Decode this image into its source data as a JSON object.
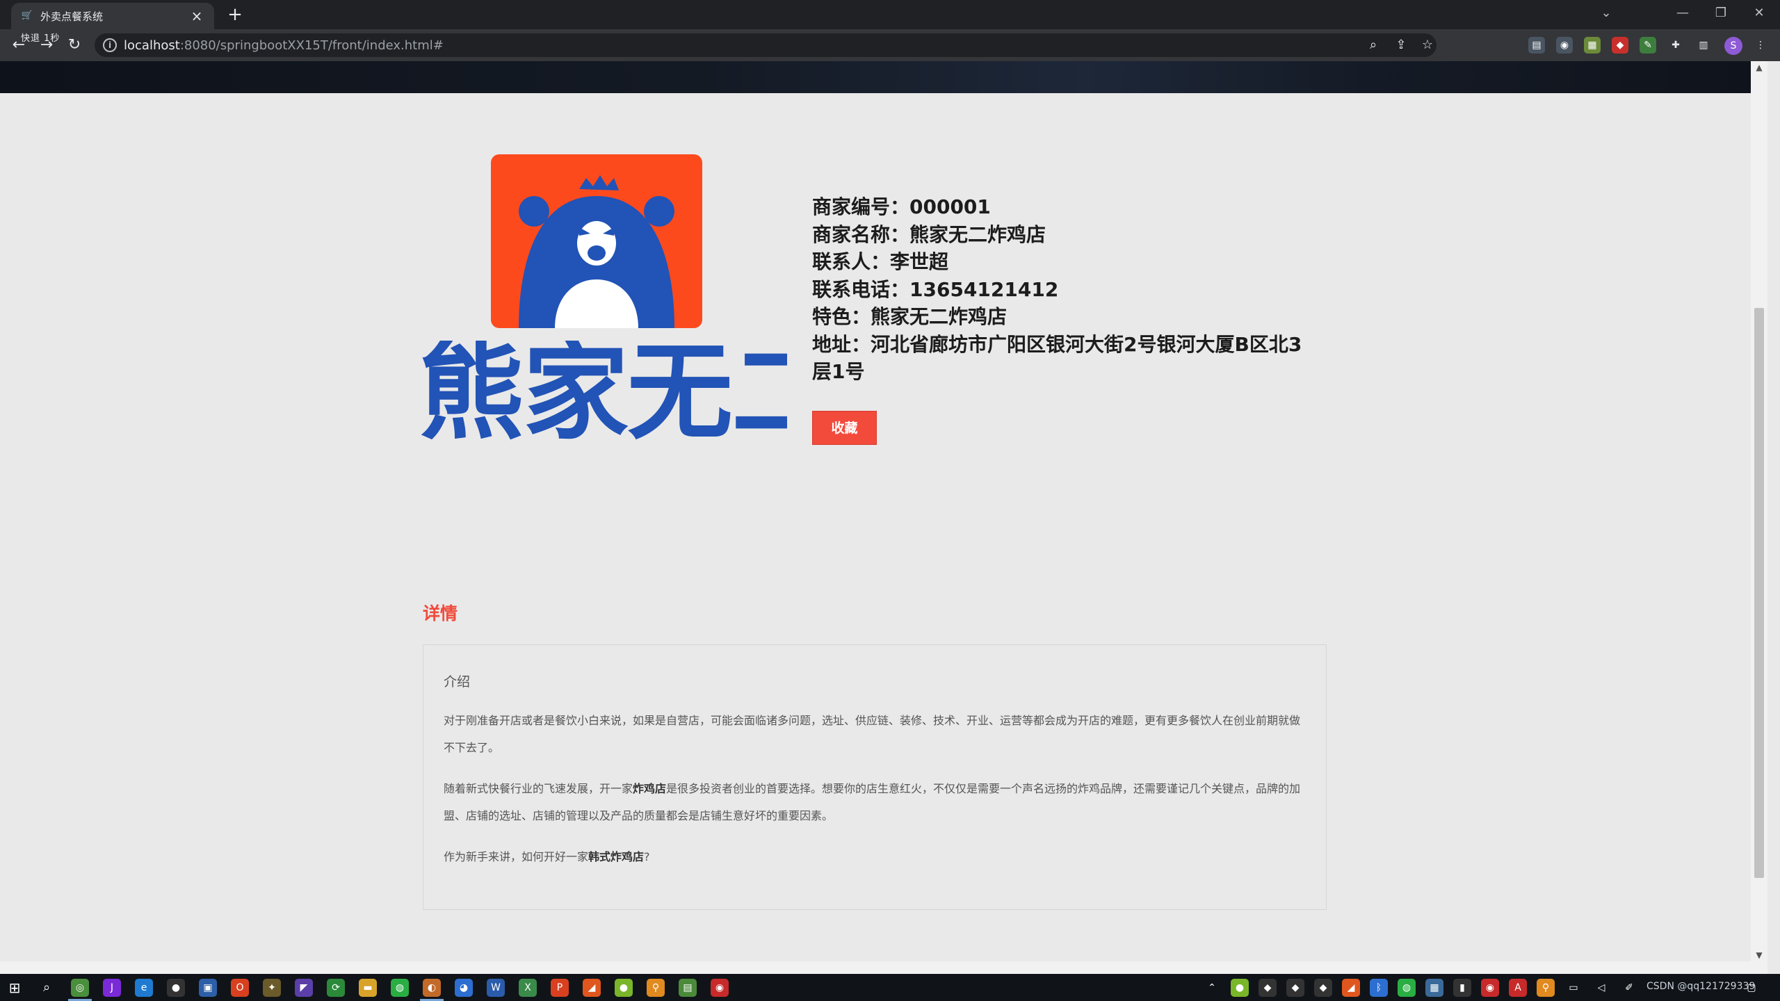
{
  "browser": {
    "tab_title": "外卖点餐系统",
    "tab_close": "×",
    "new_tab": "+",
    "nav_hint": "快退  1秒",
    "url_host": "localhost",
    "url_rest": ":8080/springbootXX15T/front/index.html#",
    "window": {
      "minimize": "—",
      "restore": "❐",
      "close": "✕",
      "tab_search": "⌄"
    },
    "avatar_letter": "S"
  },
  "merchant": {
    "logo_text": "熊家无二",
    "lines": [
      "商家编号：000001",
      "商家名称：熊家无二炸鸡店",
      "联系人：李世超",
      "联系电话：13654121412",
      "特色：熊家无二炸鸡店",
      "地址：河北省廊坊市广阳区银河大街2号银河大厦B区北3层1号"
    ],
    "favorite_button": "收藏"
  },
  "detail": {
    "title": "详情",
    "heading": "介绍",
    "para1": "对于刚准备开店或者是餐饮小白来说，如果是自营店，可能会面临诸多问题，选址、供应链、装修、技术、开业、运营等都会成为开店的难题，更有更多餐饮人在创业前期就做不下去了。",
    "para2_pre": "随着新式快餐行业的飞速发展，开一家",
    "para2_bold": "炸鸡店",
    "para2_post": "是很多投资者创业的首要选择。想要你的店生意红火，不仅仅是需要一个声名远扬的炸鸡品牌，还需要谨记几个关键点，品牌的加盟、店铺的选址、店铺的管理以及产品的质量都会是店铺生意好坏的重要因素。",
    "para3_pre": "作为新手来讲，如何开好一家",
    "para3_bold": "韩式炸鸡店",
    "para3_post": "?"
  },
  "taskbar": {
    "tray_text": "CSDN @qq121729339"
  },
  "colors": {
    "accent_red": "#f24b3c",
    "logo_orange": "#fd4a1d",
    "logo_blue": "#2253b6"
  }
}
